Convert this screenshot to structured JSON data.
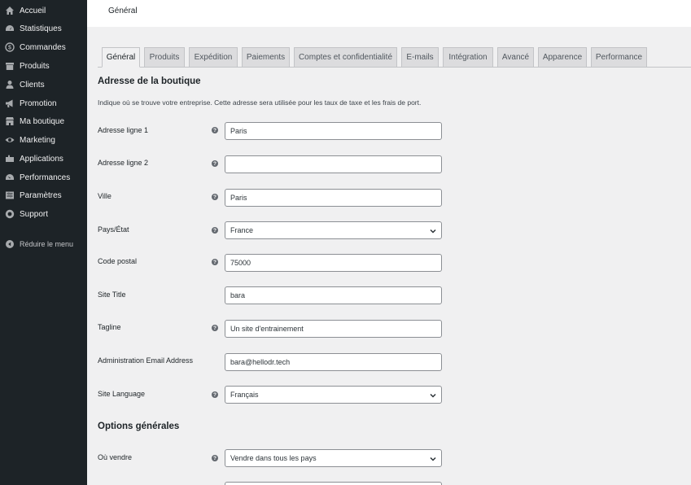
{
  "sidebar": {
    "items": [
      {
        "label": "Accueil",
        "icon": "home-icon"
      },
      {
        "label": "Statistiques",
        "icon": "dashboard-icon"
      },
      {
        "label": "Commandes",
        "icon": "dollar-icon"
      },
      {
        "label": "Produits",
        "icon": "archive-icon"
      },
      {
        "label": "Clients",
        "icon": "user-icon"
      },
      {
        "label": "Promotion",
        "icon": "megaphone-icon"
      },
      {
        "label": "Ma boutique",
        "icon": "store-icon"
      },
      {
        "label": "Marketing",
        "icon": "eye-icon"
      },
      {
        "label": "Applications",
        "icon": "puzzle-icon"
      },
      {
        "label": "Performances",
        "icon": "gauge-icon"
      },
      {
        "label": "Paramètres",
        "icon": "sliders-icon"
      },
      {
        "label": "Support",
        "icon": "help-circle-icon"
      }
    ],
    "collapse_label": "Réduire le menu"
  },
  "header": {
    "title": "Général"
  },
  "tabs": [
    {
      "label": "Général",
      "active": true
    },
    {
      "label": "Produits"
    },
    {
      "label": "Expédition"
    },
    {
      "label": "Paiements"
    },
    {
      "label": "Comptes et confidentialité"
    },
    {
      "label": "E-mails"
    },
    {
      "label": "Intégration"
    },
    {
      "label": "Avancé"
    },
    {
      "label": "Apparence"
    },
    {
      "label": "Performance"
    }
  ],
  "store_address": {
    "title": "Adresse de la boutique",
    "description": "Indique où se trouve votre entreprise. Cette adresse sera utilisée pour les taux de taxe et les frais de port.",
    "fields": [
      {
        "label": "Adresse ligne 1",
        "value": "Paris",
        "help": true,
        "type": "text"
      },
      {
        "label": "Adresse ligne 2",
        "value": "",
        "help": true,
        "type": "text"
      },
      {
        "label": "Ville",
        "value": "Paris",
        "help": true,
        "type": "text"
      },
      {
        "label": "Pays/État",
        "value": "France",
        "help": true,
        "type": "select"
      },
      {
        "label": "Code postal",
        "value": "75000",
        "help": true,
        "type": "text"
      },
      {
        "label": "Site Title",
        "value": "bara",
        "help": false,
        "type": "text"
      },
      {
        "label": "Tagline",
        "value": "Un site d'entrainement",
        "help": true,
        "type": "text"
      },
      {
        "label": "Administration Email Address",
        "value": "bara@hellodr.tech",
        "help": false,
        "type": "text"
      },
      {
        "label": "Site Language",
        "value": "Français",
        "help": true,
        "type": "select"
      }
    ]
  },
  "general_options": {
    "title": "Options générales",
    "fields": [
      {
        "label": "Où vendre",
        "value": "Vendre dans tous les pays",
        "help": true,
        "type": "select"
      }
    ]
  },
  "colors": {
    "sidebar_bg": "#1d2327",
    "content_bg": "#f0f0f1",
    "help_icon": "#646970"
  }
}
